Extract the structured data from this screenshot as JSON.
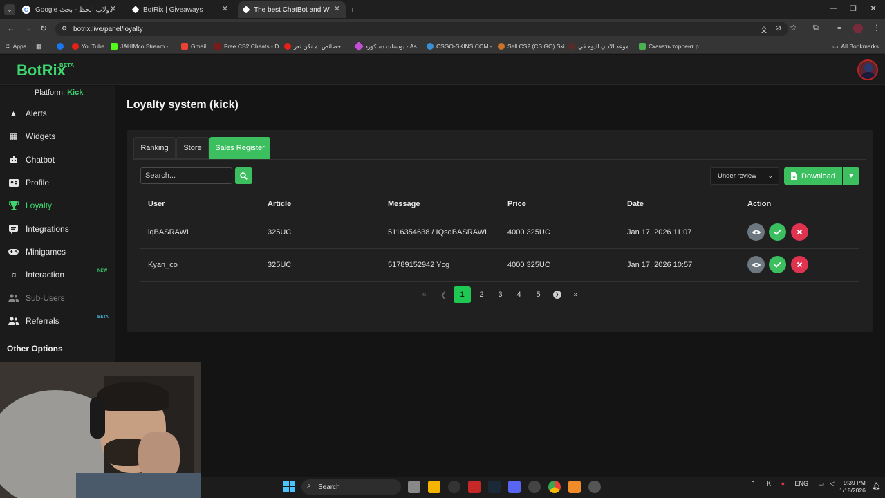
{
  "browser": {
    "tabs": [
      {
        "title": "دولاب الحظ - بحث Google",
        "icon": "google-icon"
      },
      {
        "title": "BotRix | Giveaways",
        "icon": "botrix-icon"
      },
      {
        "title": "The best ChatBot and Widgets",
        "icon": "botrix-icon"
      }
    ],
    "url": "botrix.live/panel/loyalty",
    "bookmarks": [
      "Apps",
      "YouTube",
      "JAHIMco Stream -...",
      "Gmail",
      "Free CS2 Cheats - D...",
      "خصائص لم تكن تعر...",
      "بوستات دسكورد - As...",
      "CSGO-SKINS.COM -...",
      "Sell CS2 (CS:GO) Ski...",
      "موعد الاذان اليوم في...",
      "Скачать торрент р...",
      "All Bookmarks"
    ]
  },
  "app": {
    "logo": "BotRix",
    "logo_badge": "BETA",
    "platform_label": "Platform:",
    "platform_value": "Kick"
  },
  "sidebar": {
    "items": [
      {
        "label": "Alerts",
        "icon": "warning-icon"
      },
      {
        "label": "Widgets",
        "icon": "grid-icon"
      },
      {
        "label": "Chatbot",
        "icon": "robot-icon"
      },
      {
        "label": "Profile",
        "icon": "id-card-icon"
      },
      {
        "label": "Loyalty",
        "icon": "trophy-icon",
        "active": true
      },
      {
        "label": "Integrations",
        "icon": "chat-icon"
      },
      {
        "label": "Minigames",
        "icon": "gamepad-icon"
      },
      {
        "label": "Interaction",
        "icon": "music-icon",
        "badge": "NEW"
      },
      {
        "label": "Sub-Users",
        "icon": "users-icon",
        "disabled": true
      },
      {
        "label": "Referrals",
        "icon": "user-group-icon",
        "badge": "BETA"
      }
    ],
    "other_options": "Other Options",
    "badge_colors": {
      "new": "#3ed46e",
      "beta": "#4db6d8"
    }
  },
  "page": {
    "title": "Loyalty system (kick)",
    "tabs": [
      "Ranking",
      "Store",
      "Sales Register"
    ],
    "active_tab": "Sales Register",
    "search": {
      "placeholder": "Search..."
    },
    "filter": {
      "value": "Under review"
    },
    "download_label": "Download",
    "table": {
      "headers": [
        "User",
        "Article",
        "Message",
        "Price",
        "Date",
        "Action"
      ],
      "rows": [
        {
          "user": "iqBASRAWI",
          "article": "325UC",
          "message": "5116354638 / IQsqBASRAWI",
          "price": "4000 325UC",
          "date": "Jan 17, 2026 11:07"
        },
        {
          "user": "Kyan_co",
          "article": "325UC",
          "message": "51789152942 Ycg",
          "price": "4000 325UC",
          "date": "Jan 17, 2026 10:57"
        }
      ]
    },
    "pagination": {
      "pages": [
        "1",
        "2",
        "3",
        "4",
        "5"
      ],
      "current": "1"
    }
  },
  "taskbar": {
    "search_label": "Search",
    "language": "ENG",
    "time": "9:39 PM",
    "date": "1/18/2026"
  },
  "colors": {
    "accent": "#3bbf5f",
    "danger": "#e0334f",
    "view": "#6c7780"
  }
}
